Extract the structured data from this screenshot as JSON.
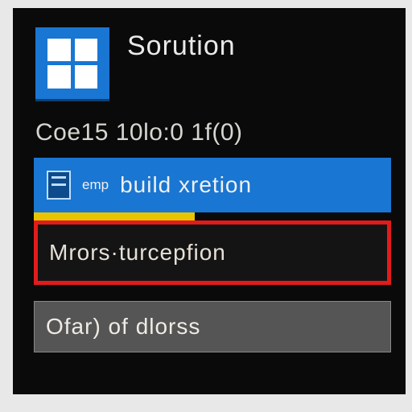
{
  "header": {
    "title": "Sorution"
  },
  "subtitle": "Coe15 10lo:0 1f(0)",
  "actions": {
    "primary": {
      "small_label": "emp",
      "label": "build xretion"
    },
    "error": {
      "label": "Mrors·turcepfion"
    },
    "neutral": {
      "label": "Ofar) of dlorss"
    }
  }
}
